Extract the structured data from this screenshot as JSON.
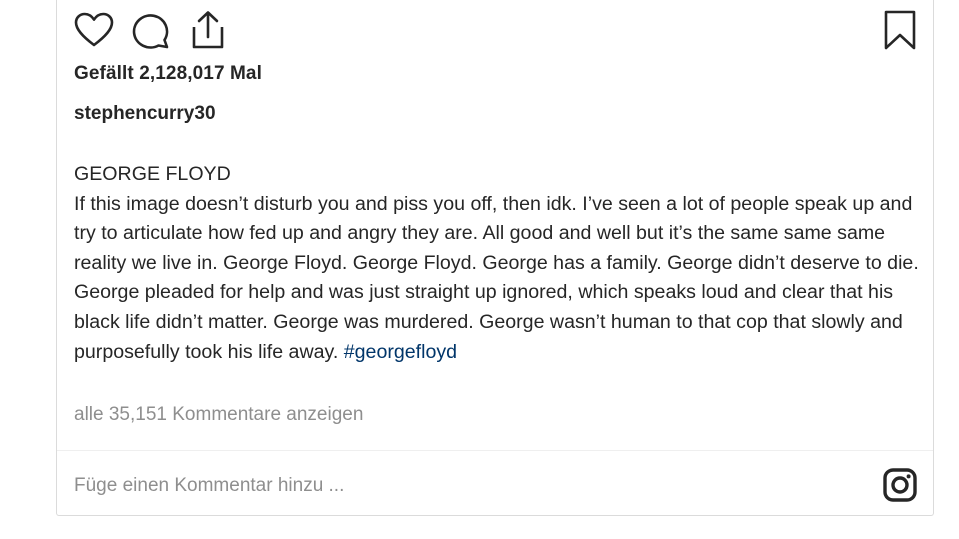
{
  "actions": {
    "like_icon": "heart-icon",
    "comment_icon": "comment-bubble-icon",
    "share_icon": "share-upload-icon",
    "save_icon": "bookmark-icon"
  },
  "post": {
    "likes_text": "Gefällt 2,128,017 Mal",
    "username": "stephencurry30",
    "caption_heading": "GEORGE FLOYD",
    "caption_body": "If this image doesn’t disturb you and piss you off, then idk. I’ve seen a lot of people speak up and try to articulate how fed up and angry they are. All good and well but it’s the same same same reality we live in. George Floyd. George Floyd. George has a family. George didn’t deserve to die. George pleaded for help and was just straight up ignored, which speaks loud and clear that his black life didn’t matter. George was murdered. George wasn’t human to that cop that slowly and purposefully took his life away.",
    "hashtag": "#georgefloyd",
    "view_comments": "alle 35,151 Kommentare anzeigen"
  },
  "comment_box": {
    "placeholder": "Füge einen Kommentar hinzu ...",
    "value": ""
  },
  "colors": {
    "text": "#262626",
    "muted": "#8e8e8e",
    "hashtag": "#003569",
    "border": "#dbdbdb"
  }
}
